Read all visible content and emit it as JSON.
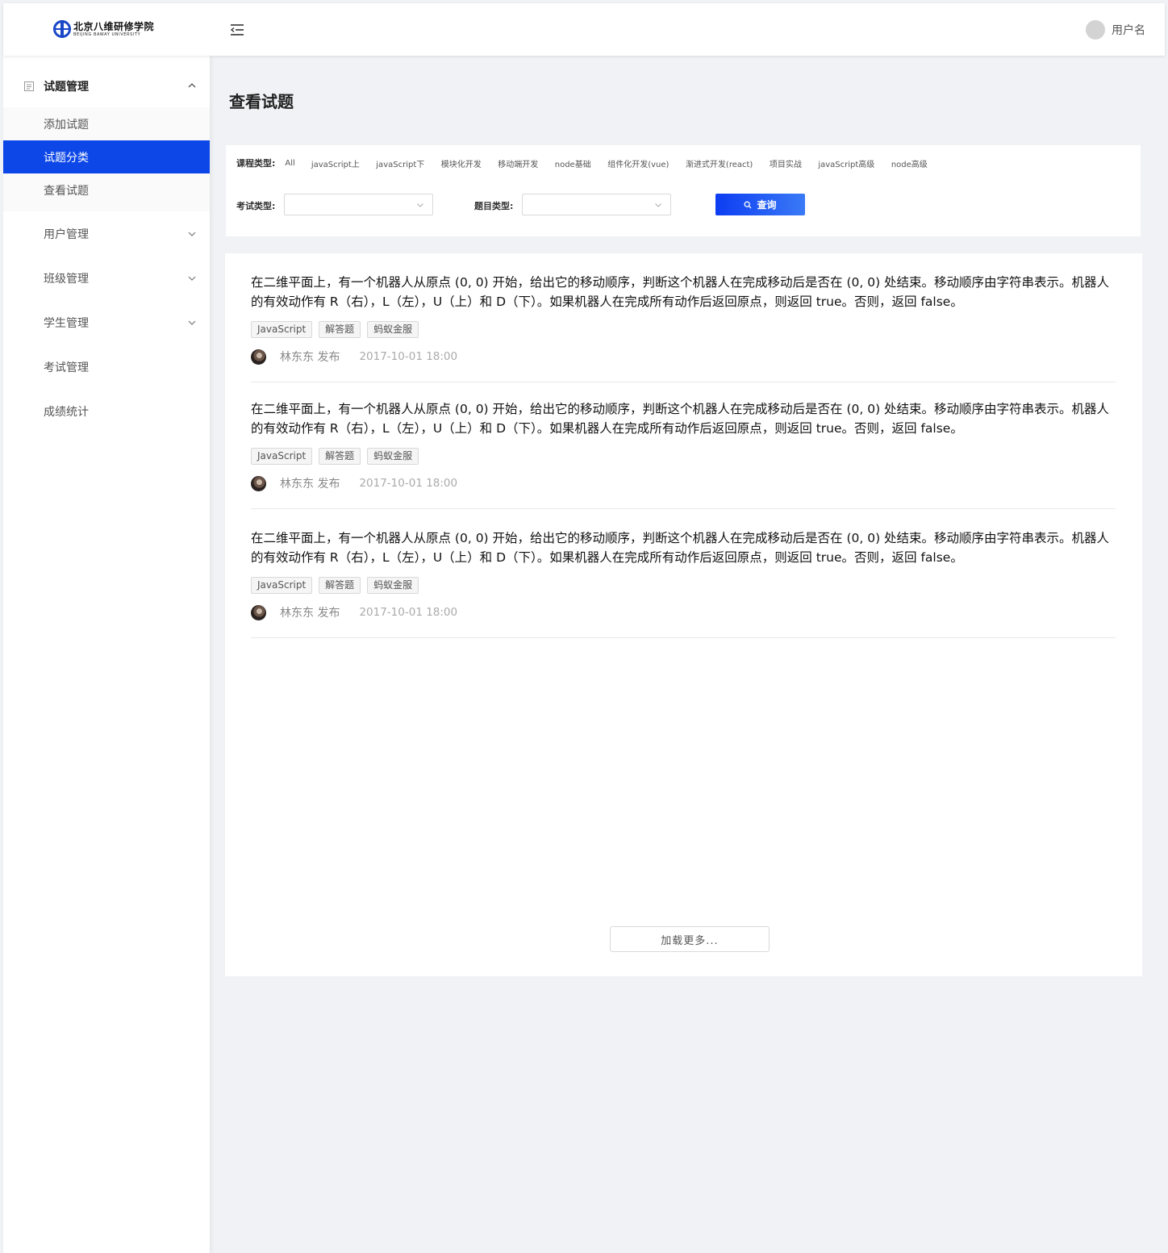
{
  "header": {
    "logo_cn": "北京八维研修学院",
    "logo_en": "BEIJING BAWAY UNIVERSITY",
    "username": "用户名"
  },
  "sidebar": {
    "groups": [
      {
        "label": "试题管理",
        "expanded": true,
        "items": [
          {
            "label": "添加试题",
            "active": false
          },
          {
            "label": "试题分类",
            "active": true
          },
          {
            "label": "查看试题",
            "active": false
          }
        ]
      },
      {
        "label": "用户管理",
        "expanded": false
      },
      {
        "label": "班级管理",
        "expanded": false
      },
      {
        "label": "学生管理",
        "expanded": false
      },
      {
        "label": "考试管理"
      },
      {
        "label": "成绩统计"
      }
    ]
  },
  "page": {
    "title": "查看试题"
  },
  "filters": {
    "course_label": "课程类型:",
    "courses": [
      "All",
      "javaScript上",
      "javaScript下",
      "模块化开发",
      "移动端开发",
      "node基础",
      "组件化开发(vue)",
      "渐进式开发(react)",
      "项目实战",
      "javaScript高级",
      "node高级"
    ],
    "exam_type_label": "考试类型:",
    "exam_type_value": "",
    "question_type_label": "题目类型:",
    "question_type_value": "",
    "query_label": "查询"
  },
  "questions": [
    {
      "text": "在二维平面上，有一个机器人从原点 (0, 0) 开始，给出它的移动顺序，判断这个机器人在完成移动后是否在 (0, 0) 处结束。移动顺序由字符串表示。机器人的有效动作有 R（右），L（左），U（上）和 D（下）。如果机器人在完成所有动作后返回原点，则返回 true。否则，返回 false。",
      "tags": [
        "JavaScript",
        "解答题",
        "蚂蚁金服"
      ],
      "author": "林东东 发布",
      "time": "2017-10-01 18:00"
    },
    {
      "text": "在二维平面上，有一个机器人从原点 (0, 0) 开始，给出它的移动顺序，判断这个机器人在完成移动后是否在 (0, 0) 处结束。移动顺序由字符串表示。机器人的有效动作有 R（右），L（左），U（上）和 D（下）。如果机器人在完成所有动作后返回原点，则返回 true。否则，返回 false。",
      "tags": [
        "JavaScript",
        "解答题",
        "蚂蚁金服"
      ],
      "author": "林东东 发布",
      "time": "2017-10-01 18:00"
    },
    {
      "text": "在二维平面上，有一个机器人从原点 (0, 0) 开始，给出它的移动顺序，判断这个机器人在完成移动后是否在 (0, 0) 处结束。移动顺序由字符串表示。机器人的有效动作有 R（右），L（左），U（上）和 D（下）。如果机器人在完成所有动作后返回原点，则返回 true。否则，返回 false。",
      "tags": [
        "JavaScript",
        "解答题",
        "蚂蚁金服"
      ],
      "author": "林东东 发布",
      "time": "2017-10-01 18:00"
    }
  ],
  "load_more": "加载更多...",
  "colors": {
    "accent": "#0d47e8",
    "button_gradient_start": "#0d3df2",
    "button_gradient_end": "#3a7af6"
  },
  "icons": {
    "menu_fold": "menu-fold-icon",
    "question_group": "file-text-icon",
    "search": "search-icon",
    "chevron": "chevron-down-icon"
  }
}
